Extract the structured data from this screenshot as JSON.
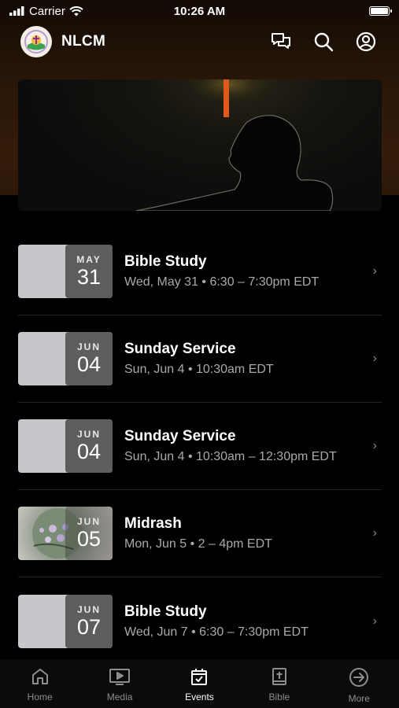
{
  "status": {
    "carrier": "Carrier",
    "time": "10:26 AM"
  },
  "app": {
    "title": "NLCM"
  },
  "events": [
    {
      "month": "MAY",
      "day": "31",
      "title": "Bible Study",
      "subtitle": "Wed, May 31 • 6:30 – 7:30pm EDT"
    },
    {
      "month": "JUN",
      "day": "04",
      "title": "Sunday Service",
      "subtitle": "Sun, Jun 4 • 10:30am EDT"
    },
    {
      "month": "JUN",
      "day": "04",
      "title": "Sunday Service",
      "subtitle": "Sun, Jun 4 • 10:30am – 12:30pm EDT"
    },
    {
      "month": "JUN",
      "day": "05",
      "title": "Midrash",
      "subtitle": "Mon, Jun 5 • 2 – 4pm EDT"
    },
    {
      "month": "JUN",
      "day": "07",
      "title": "Bible Study",
      "subtitle": "Wed, Jun 7 • 6:30 – 7:30pm EDT"
    }
  ],
  "tabs": [
    {
      "label": "Home",
      "icon": "home-icon"
    },
    {
      "label": "Media",
      "icon": "tv-icon"
    },
    {
      "label": "Events",
      "icon": "calendar-icon",
      "active": true
    },
    {
      "label": "Bible",
      "icon": "bible-icon"
    },
    {
      "label": "More",
      "icon": "arrow-circle-icon"
    }
  ]
}
